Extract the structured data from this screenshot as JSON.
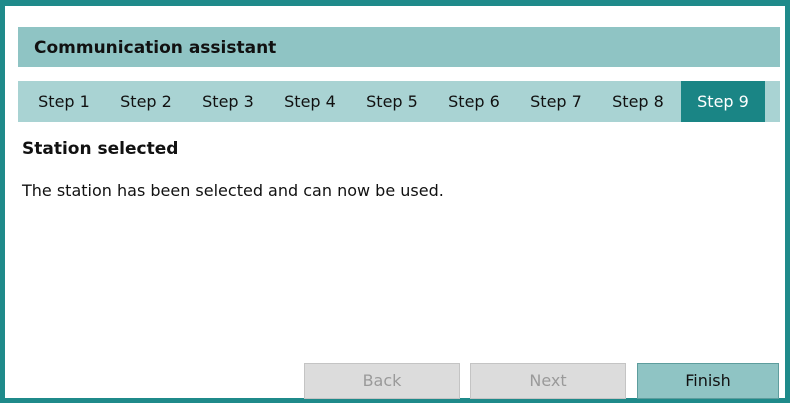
{
  "window": {
    "title": "Communication assistant"
  },
  "steps": [
    {
      "label": "Step 1"
    },
    {
      "label": "Step 2"
    },
    {
      "label": "Step 3"
    },
    {
      "label": "Step 4"
    },
    {
      "label": "Step 5"
    },
    {
      "label": "Step 6"
    },
    {
      "label": "Step 7"
    },
    {
      "label": "Step 8"
    },
    {
      "label": "Step 9"
    }
  ],
  "active_step": "Step 9",
  "content": {
    "heading": "Station selected",
    "message": "The station has been selected and can now be used."
  },
  "buttons": {
    "back_label": "Back",
    "next_label": "Next",
    "finish_label": "Finish"
  },
  "colors": {
    "frame": "#1f8a8a",
    "title_bar": "#8fc4c4",
    "steps_bar": "#a9d3d3",
    "active_step": "#1a8585",
    "disabled_button": "#dcdcdc",
    "primary_button": "#8fc4c4"
  }
}
